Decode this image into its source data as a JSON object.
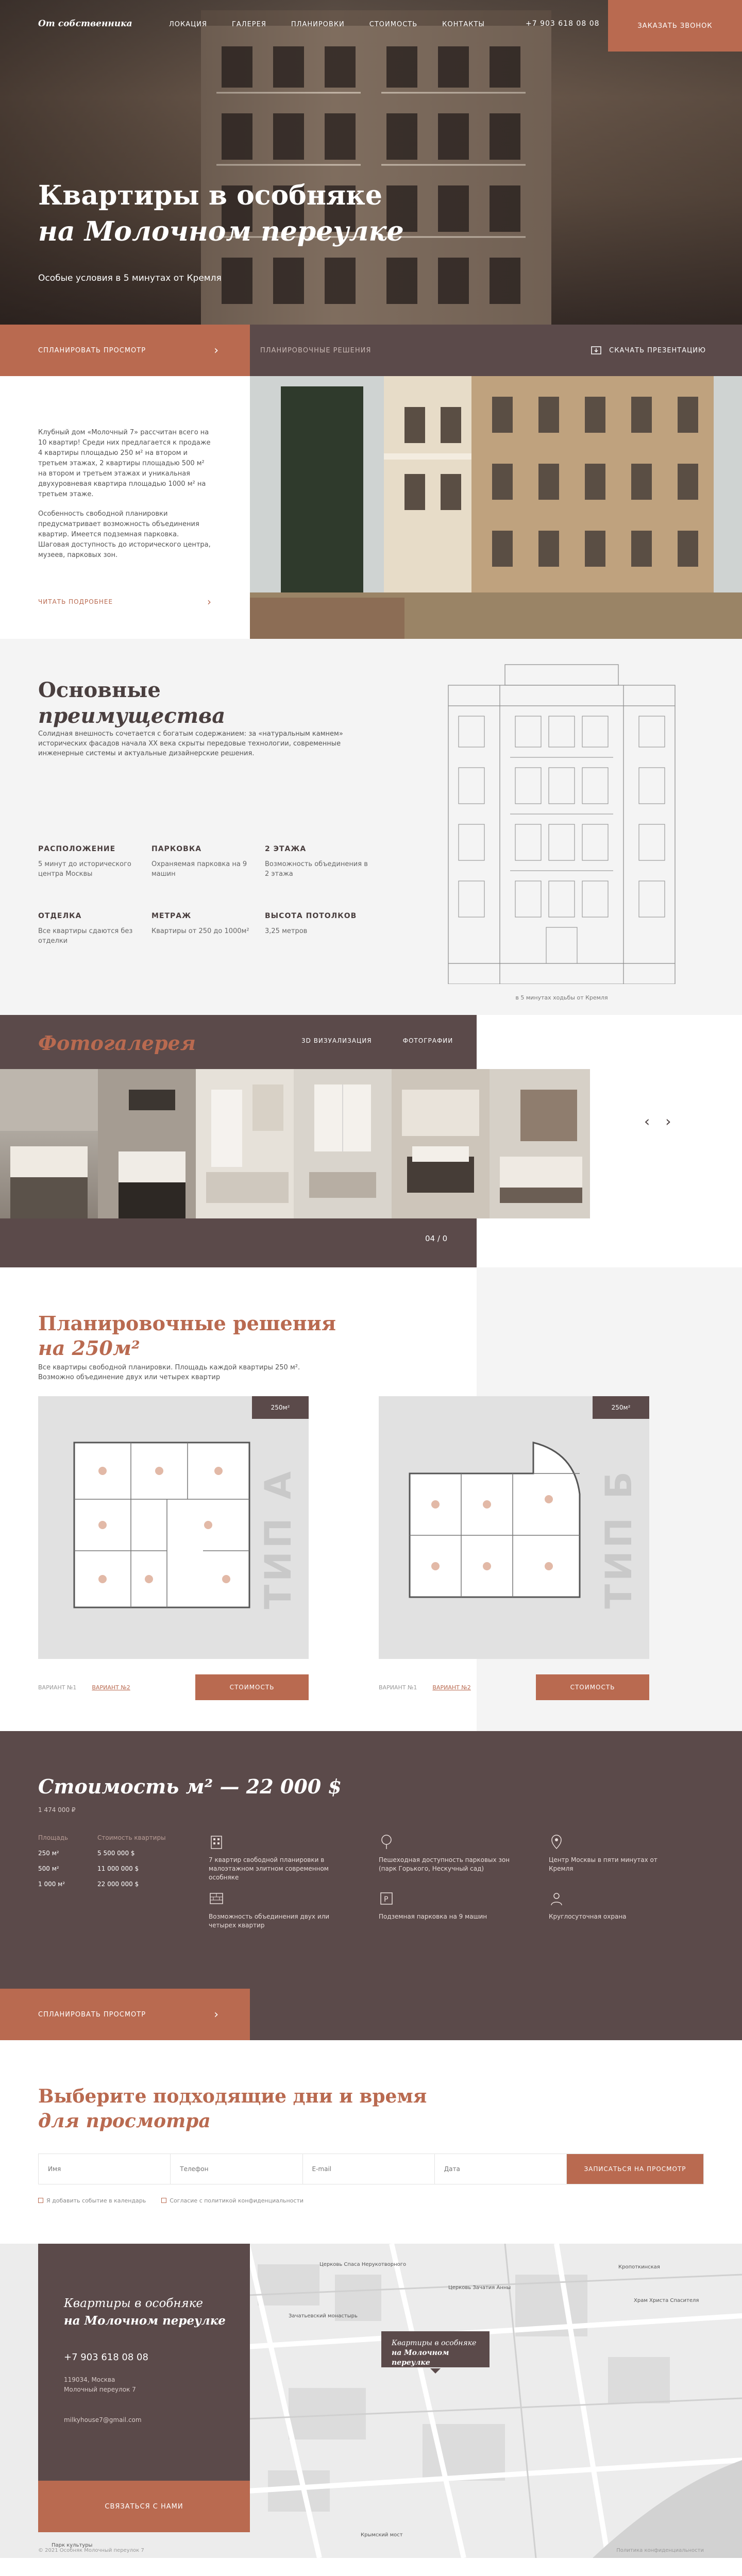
{
  "header": {
    "logo": "От собственника",
    "menu": [
      "ЛОКАЦИЯ",
      "ГАЛЕРЕЯ",
      "ПЛАНИРОВКИ",
      "СТОИМОСТЬ",
      "КОНТАКТЫ"
    ],
    "phone": "+7 903 618 08 08",
    "call_button": "ЗАКАЗАТЬ ЗВОНОК"
  },
  "hero": {
    "title_line1": "Квартиры в особняке",
    "title_line2": "на Молочном переулке",
    "subtitle": "Особые условия в 5 минутах от Кремля"
  },
  "action_bar": {
    "schedule": "СПЛАНИРОВАТЬ ПРОСМОТР",
    "plans": "ПЛАНИРОВОЧНЫЕ РЕШЕНИЯ",
    "presentation": "СКАЧАТЬ ПРЕЗЕНТАЦИЮ"
  },
  "about": {
    "p1": "Клубный дом «Молочный 7» рассчитан всего на 10 квартир! Среди них предлагается к продаже 4 квартиры площадью 250 м² на втором и третьем этажах, 2 квартиры площадью 500 м² на втором и третьем этажах и уникальная двухуровневая квартира площадью 1000 м² на третьем этаже.",
    "p2": "Особенность свободной планировки предусматривает возможность объединения квартир. Имеется подземная парковка. Шаговая доступность до исторического центра, музеев, парковых зон.",
    "read_more": "ЧИТАТЬ ПОДРОБНЕЕ"
  },
  "advantages": {
    "title_line1": "Основные",
    "title_line2": "преимущества",
    "description": "Солидная внешность сочетается с богатым содержанием: за «натуральным камнем» исторических фасадов начала XX века скрыты передовые технологии, современные инженерные системы и актуальные дизайнерские решения.",
    "items": [
      {
        "h": "РАСПОЛОЖЕНИЕ",
        "t": "5 минут до исторического центра Москвы"
      },
      {
        "h": "ПАРКОВКА",
        "t": "Охраняемая парковка на 9 машин"
      },
      {
        "h": "2 ЭТАЖА",
        "t": "Возможность объединения в 2 этажа"
      },
      {
        "h": "ОТДЕЛКА",
        "t": "Все квартиры сдаются без отделки"
      },
      {
        "h": "МЕТРАЖ",
        "t": "Квартиры от 250 до 1000м²"
      },
      {
        "h": "ВЫСОТА ПОТОЛКОВ",
        "t": "3,25 метров"
      }
    ],
    "caption": "в 5 минутах ходьбы от Кремля"
  },
  "gallery": {
    "title": "Фотогалерея",
    "tabs": [
      "3D ВИЗУАЛИЗАЦИЯ",
      "ФОТОГРАФИИ"
    ],
    "counter": "04 / 0",
    "prev": "‹",
    "next": "›"
  },
  "plans": {
    "title_line1": "Планировочные решения",
    "title_line2": "на 250м²",
    "description": "Все квартиры свободной планировки. Площадь каждой квартиры 250 м². Возможно объединение двух или четырех квартир",
    "cards": [
      {
        "area": "250м²",
        "type": "ТИП А",
        "link1": "ВАРИАНТ №1",
        "link2": "ВАРИАНТ №2",
        "button": "СТОИМОСТЬ"
      },
      {
        "area": "250м²",
        "type": "ТИП Б",
        "link1": "ВАРИАНТ №1",
        "link2": "ВАРИАНТ №2",
        "button": "СТОИМОСТЬ"
      }
    ]
  },
  "price": {
    "title_pre": "Стоимость м² — ",
    "title_val": "22 000 $",
    "subtitle": "1 474 000 ₽",
    "table_headers": [
      "Площадь",
      "Стоимость квартиры"
    ],
    "table_rows": [
      [
        "250 м²",
        "5 500 000 $"
      ],
      [
        "500 м²",
        "11 000 000 $"
      ],
      [
        "1 000 м²",
        "22 000 000 $"
      ]
    ],
    "features": [
      "7 квартир свободной планировки в малоэтажном элитном современном особняке",
      "Пешеходная доступность парковых зон (парк Горького, Нескучный сад)",
      "Центр Москвы в пяти минутах от Кремля",
      "Возможность объединения двух или четырех квартир",
      "Подземная парковка на 9 машин",
      "Круглосуточная охрана"
    ],
    "button": "СПЛАНИРОВАТЬ ПРОСМОТР"
  },
  "booking": {
    "title_line1": "Выберите подходящие дни и время",
    "title_line2": "для просмотра",
    "placeholders": [
      "Имя",
      "Телефон",
      "E-mail",
      "Дата"
    ],
    "submit": "ЗАПИСАТЬСЯ НА ПРОСМОТР",
    "check1": "Я добавить событие в календарь",
    "check2": "Согласие с политикой конфиденциальности"
  },
  "contacts": {
    "title_line1": "Квартиры в особняке",
    "title_line2": "на Молочном переулке",
    "phone": "+7 903 618 08 08",
    "address_line1": "119034, Москва",
    "address_line2": "Молочный переулок 7",
    "email": "milkyhouse7@gmail.com",
    "button": "СВЯЗАТЬСЯ С НАМИ",
    "pin_line1": "Квартиры в особняке",
    "pin_line2": "на Молочном переулке",
    "map_labels": [
      "Церковь Спаса Нерукотворного",
      "Церковь Зачатия Анны",
      "Зачатьевский монастырь",
      "Кропоткинская",
      "Парк культуры",
      "Храм Христа Спасителя",
      "Крымский мост"
    ]
  },
  "footer": {
    "left": "© 2021 Особняк Молочный переулок 7",
    "right": "Политика конфиденциальности"
  }
}
